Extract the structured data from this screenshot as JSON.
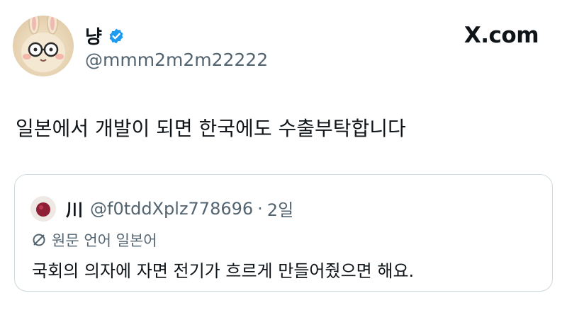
{
  "author": {
    "name": "냥",
    "handle": "@mmm2m2m22222"
  },
  "site_label": "X.com",
  "tweet": {
    "text": "일본에서 개발이 되면 한국에도 수출부탁합니다"
  },
  "quoted_tweet": {
    "name": "川",
    "handle": "@f0tddXplz778696",
    "separator": "·",
    "time": "2일",
    "translation_label": "원문 언어 일본어",
    "text": "국회의 의자에 자면 전기가 흐르게 만들어줬으면 해요."
  },
  "colors": {
    "verified": "#1d9bf0",
    "secondary_text": "#536471",
    "border": "#cfd9de"
  }
}
